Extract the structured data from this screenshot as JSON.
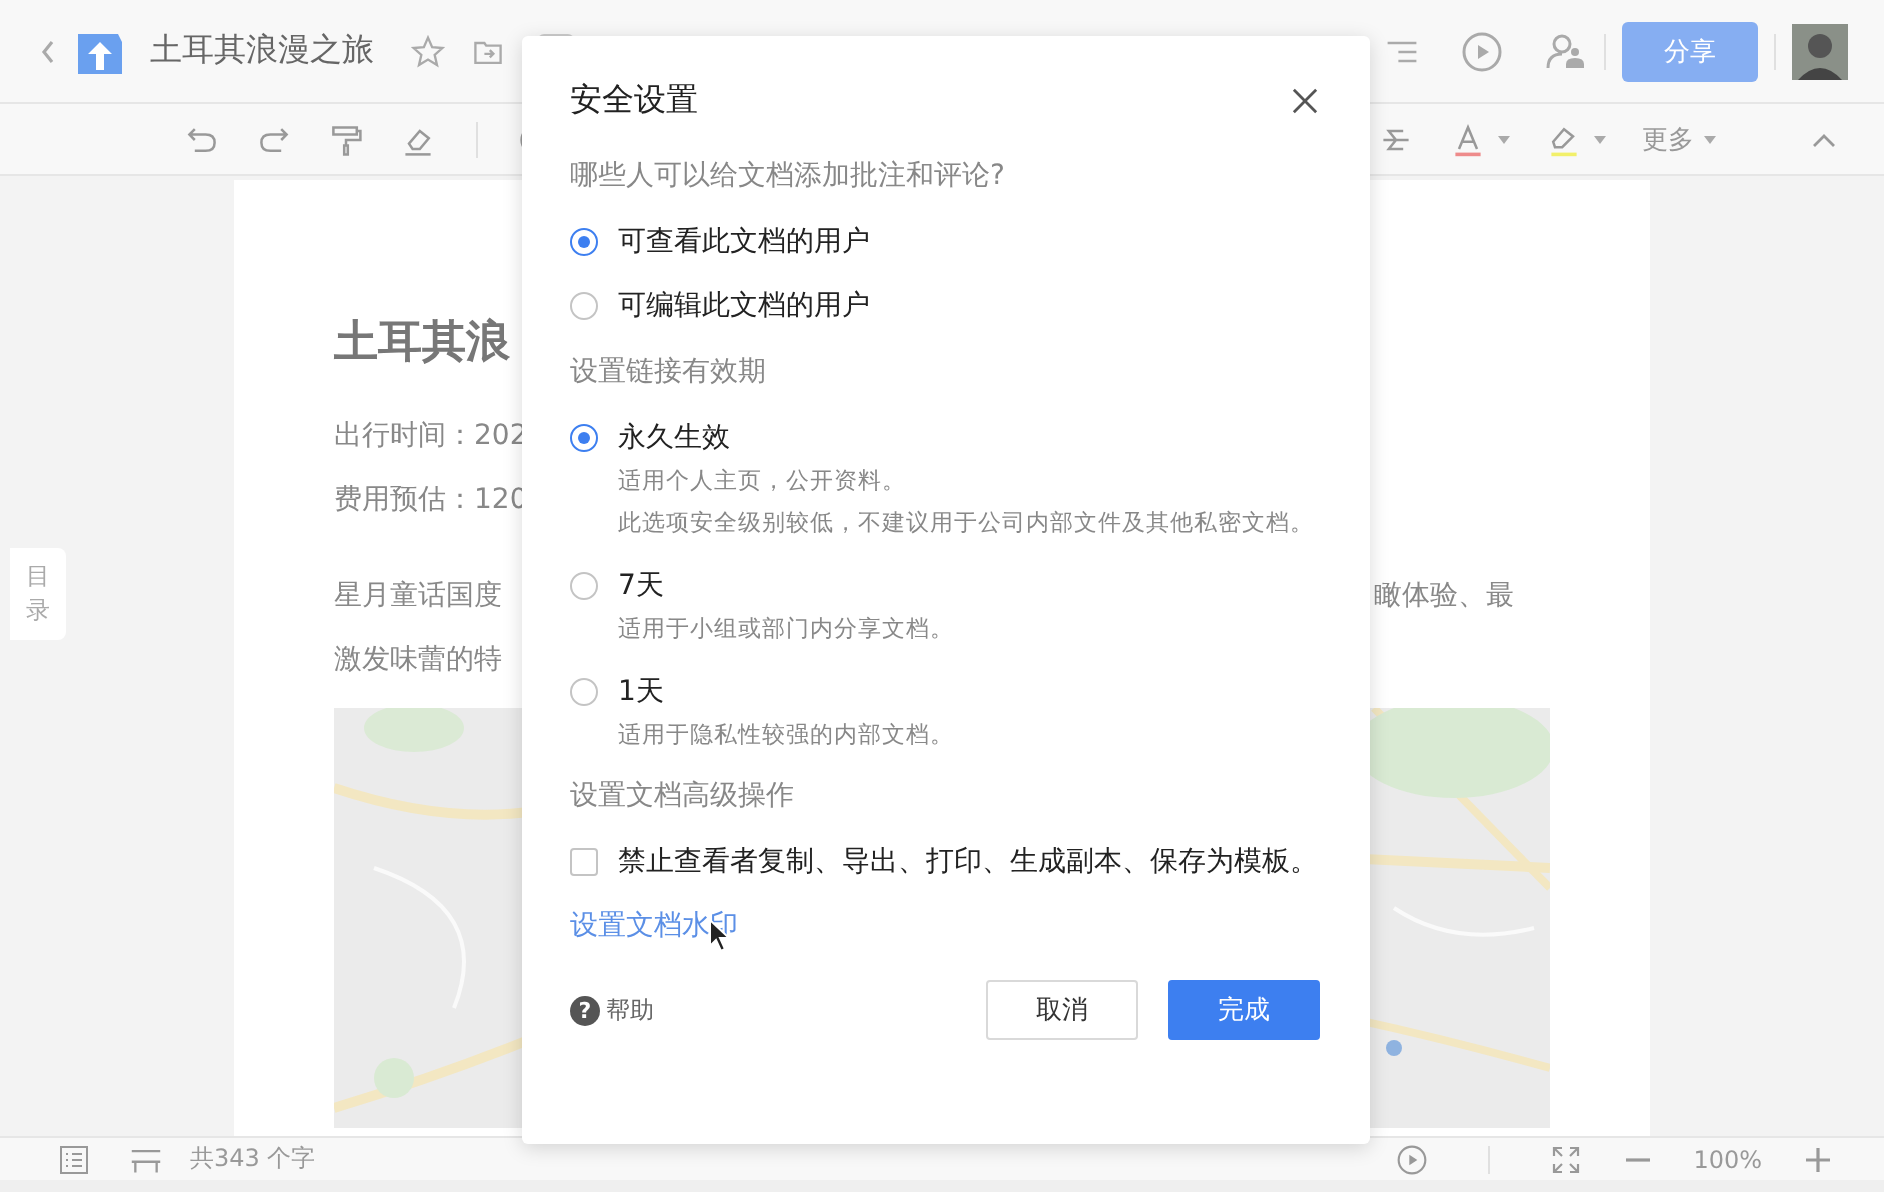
{
  "top_bar": {
    "title": "土耳其浪漫之旅",
    "share_button": "分享"
  },
  "toolbar": {
    "more": "更多"
  },
  "toc_tab": "目录",
  "document": {
    "heading": "土耳其浪",
    "lines": [
      {
        "left": "出行时间：202"
      },
      {
        "left": "费用预估：120"
      },
      {
        "left": "星月童话国度",
        "right": "瞰体验、最"
      },
      {
        "left": "激发味蕾的特"
      }
    ]
  },
  "status_bar": {
    "word_count": "共343 个字",
    "zoom": "100%"
  },
  "dialog": {
    "title": "安全设置",
    "sections": [
      {
        "heading": "哪些人可以给文档添加批注和评论?",
        "kind": "radio",
        "options": [
          {
            "label": "可查看此文档的用户",
            "selected": true
          },
          {
            "label": "可编辑此文档的用户",
            "selected": false
          }
        ]
      },
      {
        "heading": "设置链接有效期",
        "kind": "radio",
        "options": [
          {
            "label": "永久生效",
            "selected": true,
            "notes": [
              "适用个人主页，公开资料。",
              "此选项安全级别较低，不建议用于公司内部文件及其他私密文档。"
            ]
          },
          {
            "label": "7天",
            "selected": false,
            "notes": [
              "适用于小组或部门内分享文档。"
            ]
          },
          {
            "label": "1天",
            "selected": false,
            "notes": [
              "适用于隐私性较强的内部文档。"
            ]
          }
        ]
      },
      {
        "heading": "设置文档高级操作",
        "kind": "checkbox",
        "options": [
          {
            "label": "禁止查看者复制、导出、打印、生成副本、保存为模板。",
            "checked": false
          }
        ]
      }
    ],
    "link": "设置文档水印",
    "help_icon": "?",
    "help": "帮助",
    "buttons": [
      {
        "label": "取消",
        "kind": "secondary"
      },
      {
        "label": "完成",
        "kind": "primary"
      }
    ]
  }
}
